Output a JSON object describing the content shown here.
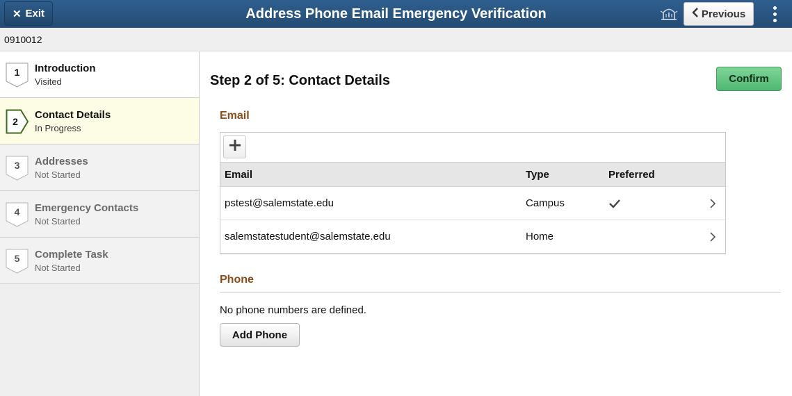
{
  "header": {
    "exit_label": "Exit",
    "title": "Address Phone Email Emergency Verification",
    "previous_label": "Previous"
  },
  "idbar": {
    "id": "0910012"
  },
  "steps": [
    {
      "number": "1",
      "title": "Introduction",
      "status": "Visited"
    },
    {
      "number": "2",
      "title": "Contact Details",
      "status": "In Progress"
    },
    {
      "number": "3",
      "title": "Addresses",
      "status": "Not Started"
    },
    {
      "number": "4",
      "title": "Emergency Contacts",
      "status": "Not Started"
    },
    {
      "number": "5",
      "title": "Complete Task",
      "status": "Not Started"
    }
  ],
  "main": {
    "page_title": "Step 2 of 5: Contact Details",
    "confirm_label": "Confirm",
    "email": {
      "section_title": "Email",
      "headers": {
        "email": "Email",
        "type": "Type",
        "preferred": "Preferred"
      },
      "rows": [
        {
          "email": "pstest@salemstate.edu",
          "type": "Campus",
          "preferred": true
        },
        {
          "email": "salemstatestudent@salemstate.edu",
          "type": "Home",
          "preferred": false
        }
      ]
    },
    "phone": {
      "section_title": "Phone",
      "empty_text": "No phone numbers are defined.",
      "add_label": "Add Phone"
    }
  },
  "colors": {
    "header_bg": "#2c5a87",
    "section_title": "#8b4b16",
    "confirm_bg": "#5cbf7b",
    "active_step_bg": "#fdfde6"
  }
}
